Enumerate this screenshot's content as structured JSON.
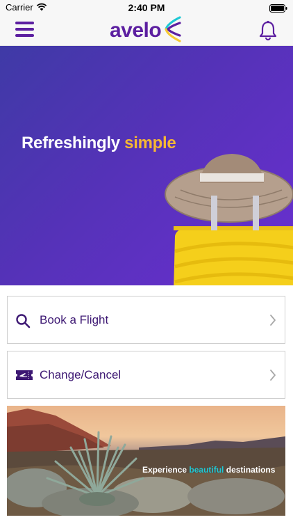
{
  "status_bar": {
    "carrier": "Carrier",
    "time": "2:40 PM"
  },
  "header": {
    "logo_text": "avelo",
    "brand_color": "#5c1fa0",
    "icons": [
      "menu-icon",
      "bell-icon"
    ]
  },
  "hero": {
    "title_main": "Refreshingly",
    "title_accent": "simple",
    "accent_color": "#f7b733"
  },
  "actions": [
    {
      "label": "Book a Flight",
      "icon": "search-icon"
    },
    {
      "label": "Change/Cancel",
      "icon": "ticket-icon"
    }
  ],
  "banner": {
    "text_before": "Experience",
    "text_accent": "beautiful",
    "text_after": "destinations",
    "accent_color": "#1ec8d4"
  }
}
